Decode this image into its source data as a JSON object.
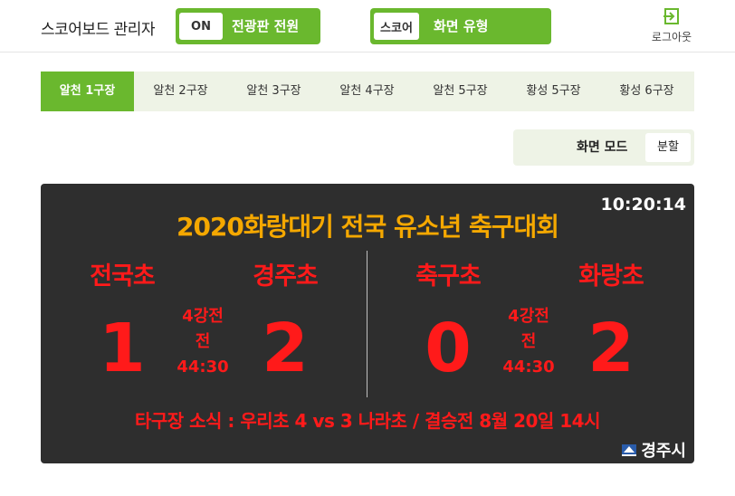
{
  "header": {
    "app_title": "스코어보드 관리자",
    "power": {
      "chip": "ON",
      "label": "전광판 전원"
    },
    "screen_type": {
      "chip": "스코어",
      "label": "화면 유형"
    },
    "logout_label": "로그아웃",
    "logout_icon": "logout-icon"
  },
  "tabs": [
    "알천 1구장",
    "알천 2구장",
    "알천 3구장",
    "알천 4구장",
    "알천 5구장",
    "황성 5구장",
    "황성 6구장"
  ],
  "active_tab": 0,
  "screen_mode": {
    "label": "화면 모드",
    "value": "분할"
  },
  "board": {
    "clock": "10:20:14",
    "title": "2020화랑대기 전국 유소년 축구대회",
    "matches": [
      {
        "home": "전국초",
        "away": "경주초",
        "home_score": "1",
        "away_score": "2",
        "round": "4강전",
        "half": "전",
        "time": "44:30"
      },
      {
        "home": "축구초",
        "away": "화랑초",
        "home_score": "0",
        "away_score": "2",
        "round": "4강전",
        "half": "전",
        "time": "44:30"
      }
    ],
    "news": "타구장 소식 : 우리초 4 vs 3 나라초 / 결승전 8월 20일 14시",
    "city": "경주시",
    "city_icon": "city-emblem-icon"
  },
  "colors": {
    "accent": "#6ab82e",
    "tab_bg": "#eef3e6",
    "board_bg": "#2e2e2e",
    "title": "#f5a800",
    "score": "#ff1a1a"
  }
}
